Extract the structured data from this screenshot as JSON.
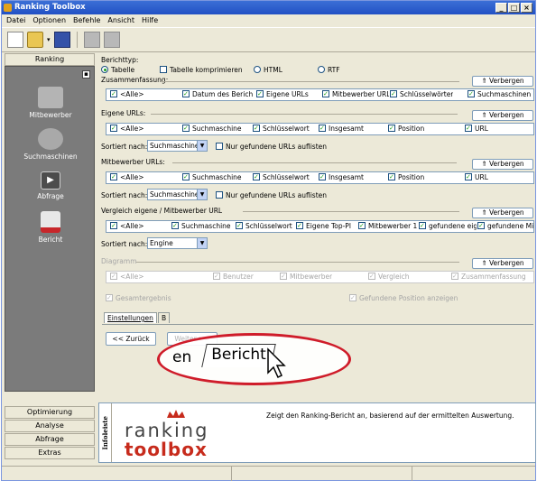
{
  "window": {
    "title": "Ranking Toolbox",
    "minimize": "_",
    "maximize": "□",
    "close": "×"
  },
  "menu": [
    "Datei",
    "Optionen",
    "Befehle",
    "Ansicht",
    "Hilfe"
  ],
  "sidebar": {
    "header": "Ranking",
    "collapse": "▪",
    "items": [
      {
        "label": "Mitbewerber",
        "icon": "people-icon"
      },
      {
        "label": "Suchmaschinen",
        "icon": "gears-icon"
      },
      {
        "label": "Abfrage",
        "icon": "play-icon"
      },
      {
        "label": "Bericht",
        "icon": "report-icon"
      }
    ],
    "bottom": [
      "Optimierung",
      "Analyse",
      "Abfrage",
      "Extras"
    ]
  },
  "report": {
    "type_label": "Berichttyp:",
    "types": [
      {
        "label": "Tabelle",
        "kind": "radio",
        "checked": true
      },
      {
        "label": "Tabelle komprimieren",
        "kind": "checkbox",
        "checked": false
      },
      {
        "label": "HTML",
        "kind": "radio",
        "checked": false
      },
      {
        "label": "RTF",
        "kind": "radio",
        "checked": false
      }
    ]
  },
  "summary": {
    "label": "Zusammenfassung:",
    "toggle": "⇑ Verbergen",
    "cols": [
      "<Alle>",
      "Datum des Berich",
      "Eigene URLs",
      "Mitbewerber URL",
      "Schlüsselwörter",
      "Suchmaschinen"
    ]
  },
  "own": {
    "label": "Eigene URLs:",
    "toggle": "⇑ Verbergen",
    "cols": [
      "<Alle>",
      "Suchmaschine",
      "Schlüsselwort",
      "Insgesamt",
      "Position",
      "URL"
    ],
    "sort_label": "Sortiert nach:",
    "sort_value": "Suchmaschine",
    "only_found": "Nur gefundene URLs auflisten"
  },
  "competitor": {
    "label": "Mitbewerber URLs:",
    "toggle": "⇑ Verbergen",
    "cols": [
      "<Alle>",
      "Suchmaschine",
      "Schlüsselwort",
      "Insgesamt",
      "Position",
      "URL"
    ],
    "sort_label": "Sortiert nach:",
    "sort_value": "Suchmaschine",
    "only_found": "Nur gefundene URLs auflisten"
  },
  "compare": {
    "label": "Vergleich eigene / Mitbewerber URL",
    "toggle": "⇑ Verbergen",
    "cols": [
      "<Alle>",
      "Suchmaschine",
      "Schlüsselwort",
      "Eigene Top-Pl",
      "Mitbewerber 1",
      "gefundene eig",
      "gefundene Mi"
    ],
    "sort_label": "Sortiert nach:",
    "sort_value": "Engine"
  },
  "diagram": {
    "label": "Diagramm",
    "toggle": "⇑ Verbergen",
    "cols": [
      "<Alle>",
      "Benutzer",
      "Mitbewerber",
      "Vergleich",
      "Zusammenfassung"
    ],
    "total": "Gesamtergebnis",
    "found_pos": "Gefundene Position anzeigen"
  },
  "tabs": {
    "settings": "Einstellungen",
    "report_small": "B"
  },
  "nav": {
    "back": "<< Zurück",
    "next": "Weiter >>"
  },
  "zoom": {
    "tab_left": "en",
    "tab_right": "Bericht"
  },
  "info": {
    "tab": "Infoleiste",
    "logo_line1": "ranking",
    "logo_line2": "toolbox",
    "text": "Zeigt den Ranking-Bericht an, basierend auf der ermittelten Auswertung."
  },
  "colors": {
    "accent": "#21a121",
    "highlight": "#cf1c2a",
    "title": "#2251c4",
    "sidebar": "#7b7b7b"
  }
}
